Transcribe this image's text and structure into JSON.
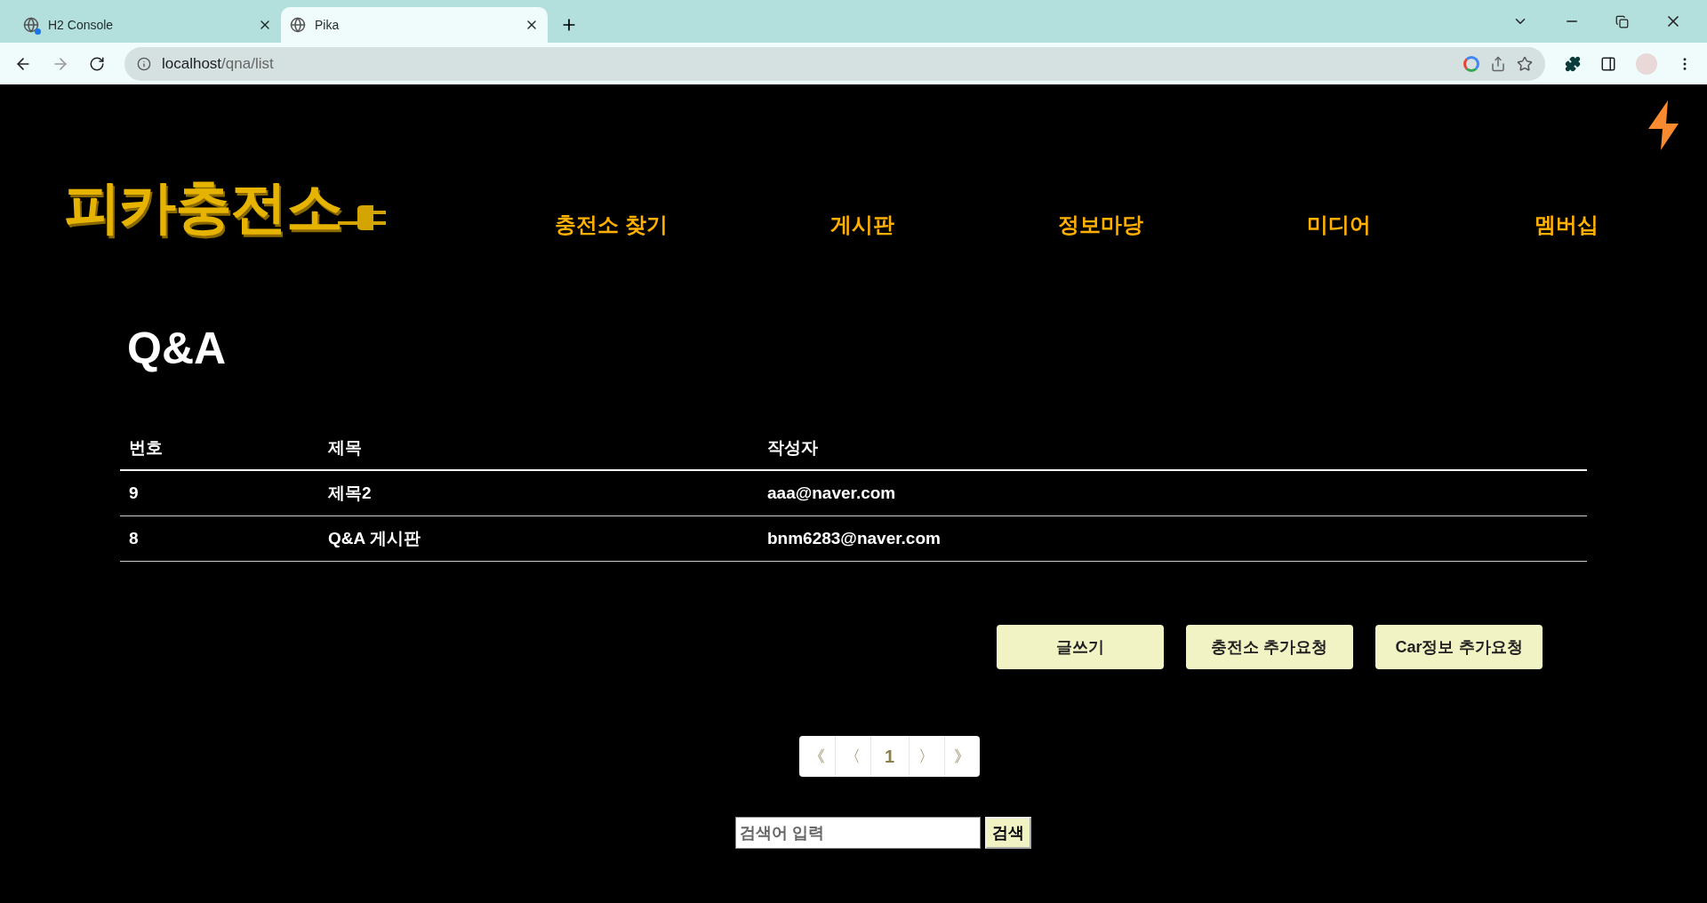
{
  "browser": {
    "tabs": [
      {
        "title": "H2 Console",
        "selected": false,
        "notification": true
      },
      {
        "title": "Pika",
        "selected": true,
        "notification": false
      }
    ],
    "url_host": "localhost",
    "url_path": "/qna/list"
  },
  "site": {
    "logo": "피카충전소",
    "nav": [
      "충전소 찾기",
      "게시판",
      "정보마당",
      "미디어",
      "멤버십"
    ]
  },
  "heading": "Q&A",
  "table": {
    "columns": [
      "번호",
      "제목",
      "작성자"
    ],
    "rows": [
      [
        "9",
        "제목2",
        "aaa@naver.com"
      ],
      [
        "8",
        "Q&A 게시판",
        "bnm6283@naver.com"
      ]
    ]
  },
  "actions": [
    "글쓰기",
    "충전소 추가요청",
    "Car정보 추가요청"
  ],
  "pagination": [
    {
      "label": "《",
      "kind": "first"
    },
    {
      "label": "〈",
      "kind": "prev"
    },
    {
      "label": "1",
      "kind": "page"
    },
    {
      "label": "〉",
      "kind": "next"
    },
    {
      "label": "》",
      "kind": "last"
    }
  ],
  "search": {
    "placeholder": "검색어 입력",
    "button": "검색"
  }
}
